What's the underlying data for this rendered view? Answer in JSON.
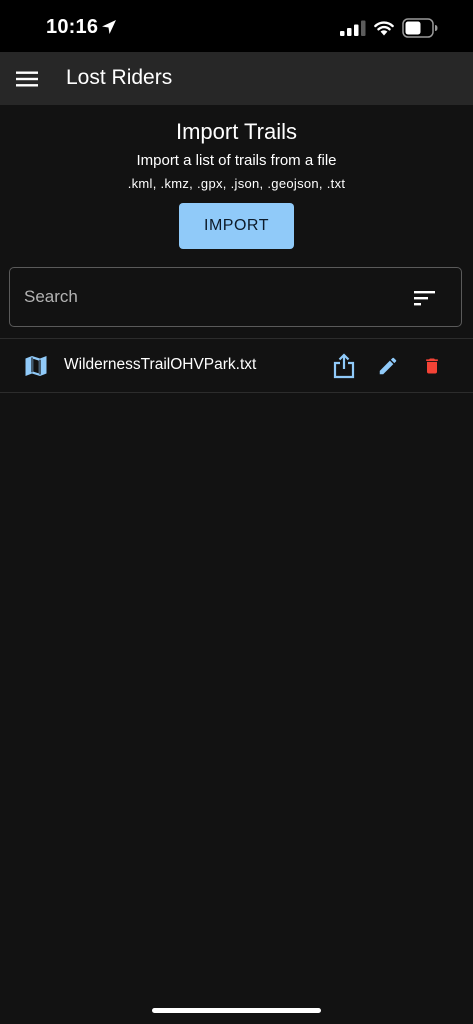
{
  "status_bar": {
    "time": "10:16",
    "icons": [
      "location-arrow-icon",
      "cellular-signal-icon",
      "wifi-icon",
      "battery-icon"
    ]
  },
  "app_bar": {
    "title": "Lost Riders",
    "menu_icon": "hamburger-menu-icon"
  },
  "import": {
    "title": "Import Trails",
    "subtitle": "Import a list of trails from a file",
    "formats": ".kml, .kmz, .gpx, .json, .geojson, .txt",
    "button_label": "IMPORT"
  },
  "search": {
    "placeholder": "Search",
    "value": "",
    "sort_icon": "sort-icon"
  },
  "trails": [
    {
      "name": "WildernessTrailOHVPark.txt",
      "icon": "map-icon",
      "actions": [
        "share-icon",
        "edit-icon",
        "delete-icon"
      ]
    }
  ],
  "colors": {
    "background": "#121212",
    "app_bar": "#272727",
    "accent": "#90caf9",
    "delete": "#f44336"
  }
}
